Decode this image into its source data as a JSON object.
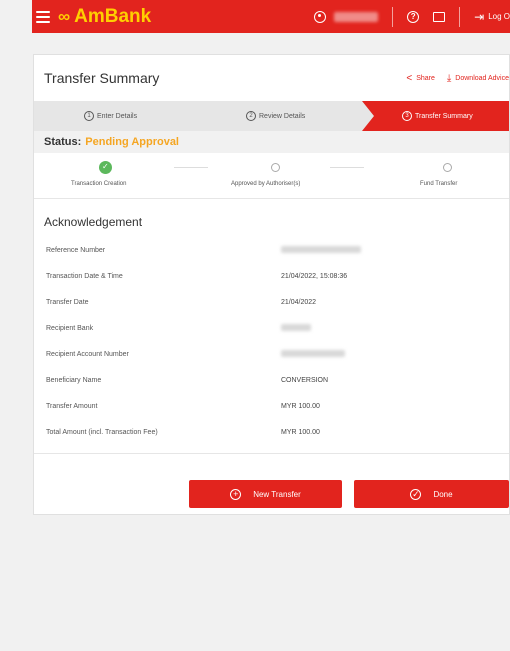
{
  "brand": {
    "logo_mark": "∞",
    "logo_text": "AmBank",
    "accent": "#e2241e",
    "logo_color": "#ffcf00"
  },
  "topbar": {
    "logout_label": "Log O"
  },
  "summary": {
    "title": "Transfer Summary",
    "share_label": "Share",
    "download_label": "Download Advice"
  },
  "steps": [
    {
      "num": "1",
      "label": "Enter Details"
    },
    {
      "num": "2",
      "label": "Review Details"
    },
    {
      "num": "3",
      "label": "Transfer Summary"
    }
  ],
  "status": {
    "label": "Status:",
    "value": "Pending Approval",
    "color": "#f5a623"
  },
  "progress": [
    {
      "label": "Transaction Creation"
    },
    {
      "label": "Approved by Authoriser(s)"
    },
    {
      "label": "Fund Transfer"
    }
  ],
  "ack": {
    "title": "Acknowledgement",
    "rows": [
      {
        "label": "Reference Number",
        "value": ""
      },
      {
        "label": "Transaction Date & Time",
        "value": "21/04/2022, 15:08:36"
      },
      {
        "label": "Transfer Date",
        "value": "21/04/2022"
      },
      {
        "label": "Recipient Bank",
        "value": ""
      },
      {
        "label": "Recipient Account Number",
        "value": ""
      },
      {
        "label": "Beneficiary Name",
        "value": "CONVERSION"
      },
      {
        "label": "Transfer Amount",
        "value": "MYR 100.00"
      },
      {
        "label": "Total Amount (incl. Transaction Fee)",
        "value": "MYR 100.00"
      }
    ]
  },
  "buttons": {
    "new_transfer": "New Transfer",
    "done": "Done"
  }
}
